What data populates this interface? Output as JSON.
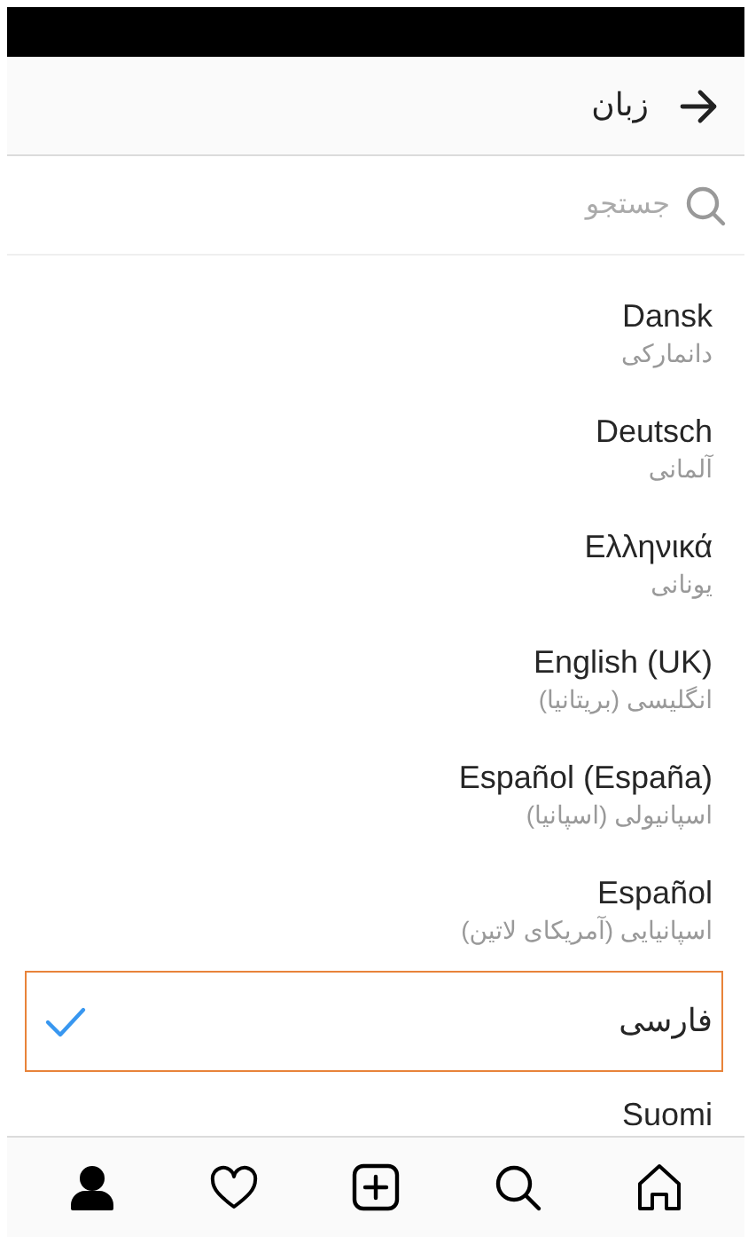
{
  "header": {
    "title": "زبان"
  },
  "search": {
    "placeholder": "جستجو"
  },
  "languages": [
    {
      "name": "Dansk",
      "native": "دانمارکی",
      "selected": false
    },
    {
      "name": "Deutsch",
      "native": "آلمانی",
      "selected": false
    },
    {
      "name": "Ελληνικά",
      "native": "یونانی",
      "selected": false
    },
    {
      "name": "English (UK)",
      "native": "انگلیسی (بریتانیا)",
      "selected": false
    },
    {
      "name": "Español (España)",
      "native": "اسپانیولی (اسپانیا)",
      "selected": false
    },
    {
      "name": "Español",
      "native": "اسپانیایی (آمریکای لاتین)",
      "selected": false
    },
    {
      "name": "فارسی",
      "selected": true
    },
    {
      "name": "Suomi",
      "selected": false
    }
  ],
  "tab_bar": [
    {
      "kind": "profile",
      "selected": true
    },
    {
      "kind": "heart",
      "selected": false
    },
    {
      "kind": "add",
      "selected": false
    },
    {
      "kind": "search",
      "selected": false
    },
    {
      "kind": "home",
      "selected": false
    }
  ]
}
